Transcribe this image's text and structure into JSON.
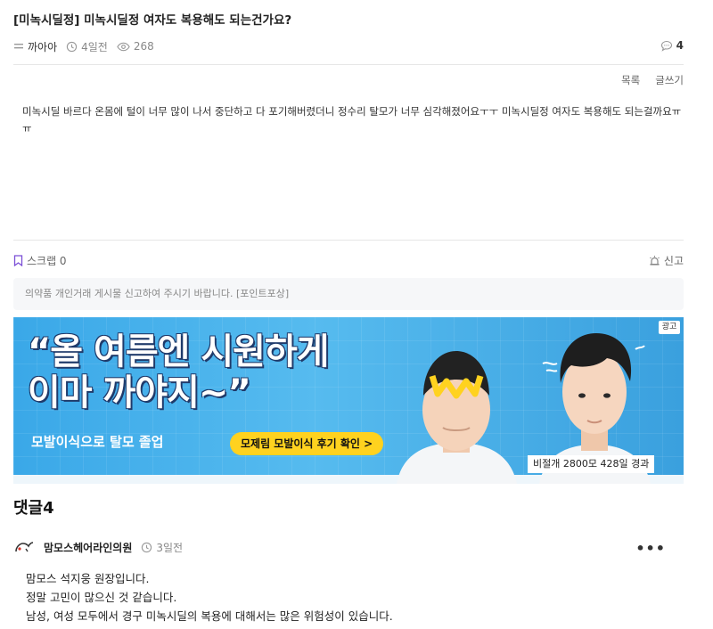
{
  "post": {
    "title": "[미녹시딜정] 미녹시딜정 여자도 복용해도 되는건가요?",
    "author": "까아아",
    "time": "4일전",
    "views": "268",
    "comment_count": "4"
  },
  "actions": {
    "list": "목록",
    "write": "글쓰기"
  },
  "body": "미녹시딜 바르다 온몸에 털이 너무 많이 나서 중단하고 다 포기해버렸더니 정수리 탈모가 너무 심각해졌어요ㅜㅜ 미녹시딜정 여자도 복용해도 되는걸까요ㅠㅠ",
  "scrap": {
    "label": "스크랩 0"
  },
  "report": {
    "label": "신고"
  },
  "notice": "의약품 개인거래 게시물 신고하여 주시기 바랍니다. [포인트포상]",
  "ad": {
    "headline_1": "“올 여름엔 시원하게",
    "headline_2": "이마 까야지~”",
    "sub": "모발이식으로 탈모 졸업",
    "cta": "모제림 모발이식 후기 확인 >",
    "badge": "광고",
    "caption": "비절개 2800모 428일 경과",
    "colors": {
      "background": "#3aa8e8",
      "cta": "#ffd21f",
      "headline_outline": "#1f3a6a"
    }
  },
  "comments": {
    "title": "댓글4",
    "items": [
      {
        "author": "맘모스헤어라인의원",
        "time": "3일전",
        "lines": [
          "맘모스 석지웅 원장입니다.",
          "정말 고민이 많으신 것 같습니다.",
          "남성, 여성 모두에서 경구 미녹시딜의 복용에 대해서는 많은 위험성이 있습니다."
        ]
      }
    ]
  },
  "icons": {
    "author": "menu-lines-icon",
    "time": "clock-icon",
    "views": "eye-icon",
    "comments": "chat-bubble-icon",
    "scrap": "bookmark-icon",
    "report": "siren-icon",
    "comment_avatar": "clinic-logo-icon",
    "comment_menu": "more-dots-icon"
  },
  "colors": {
    "accent": "#7b4fd6",
    "text": "#222222",
    "muted": "#888888"
  }
}
